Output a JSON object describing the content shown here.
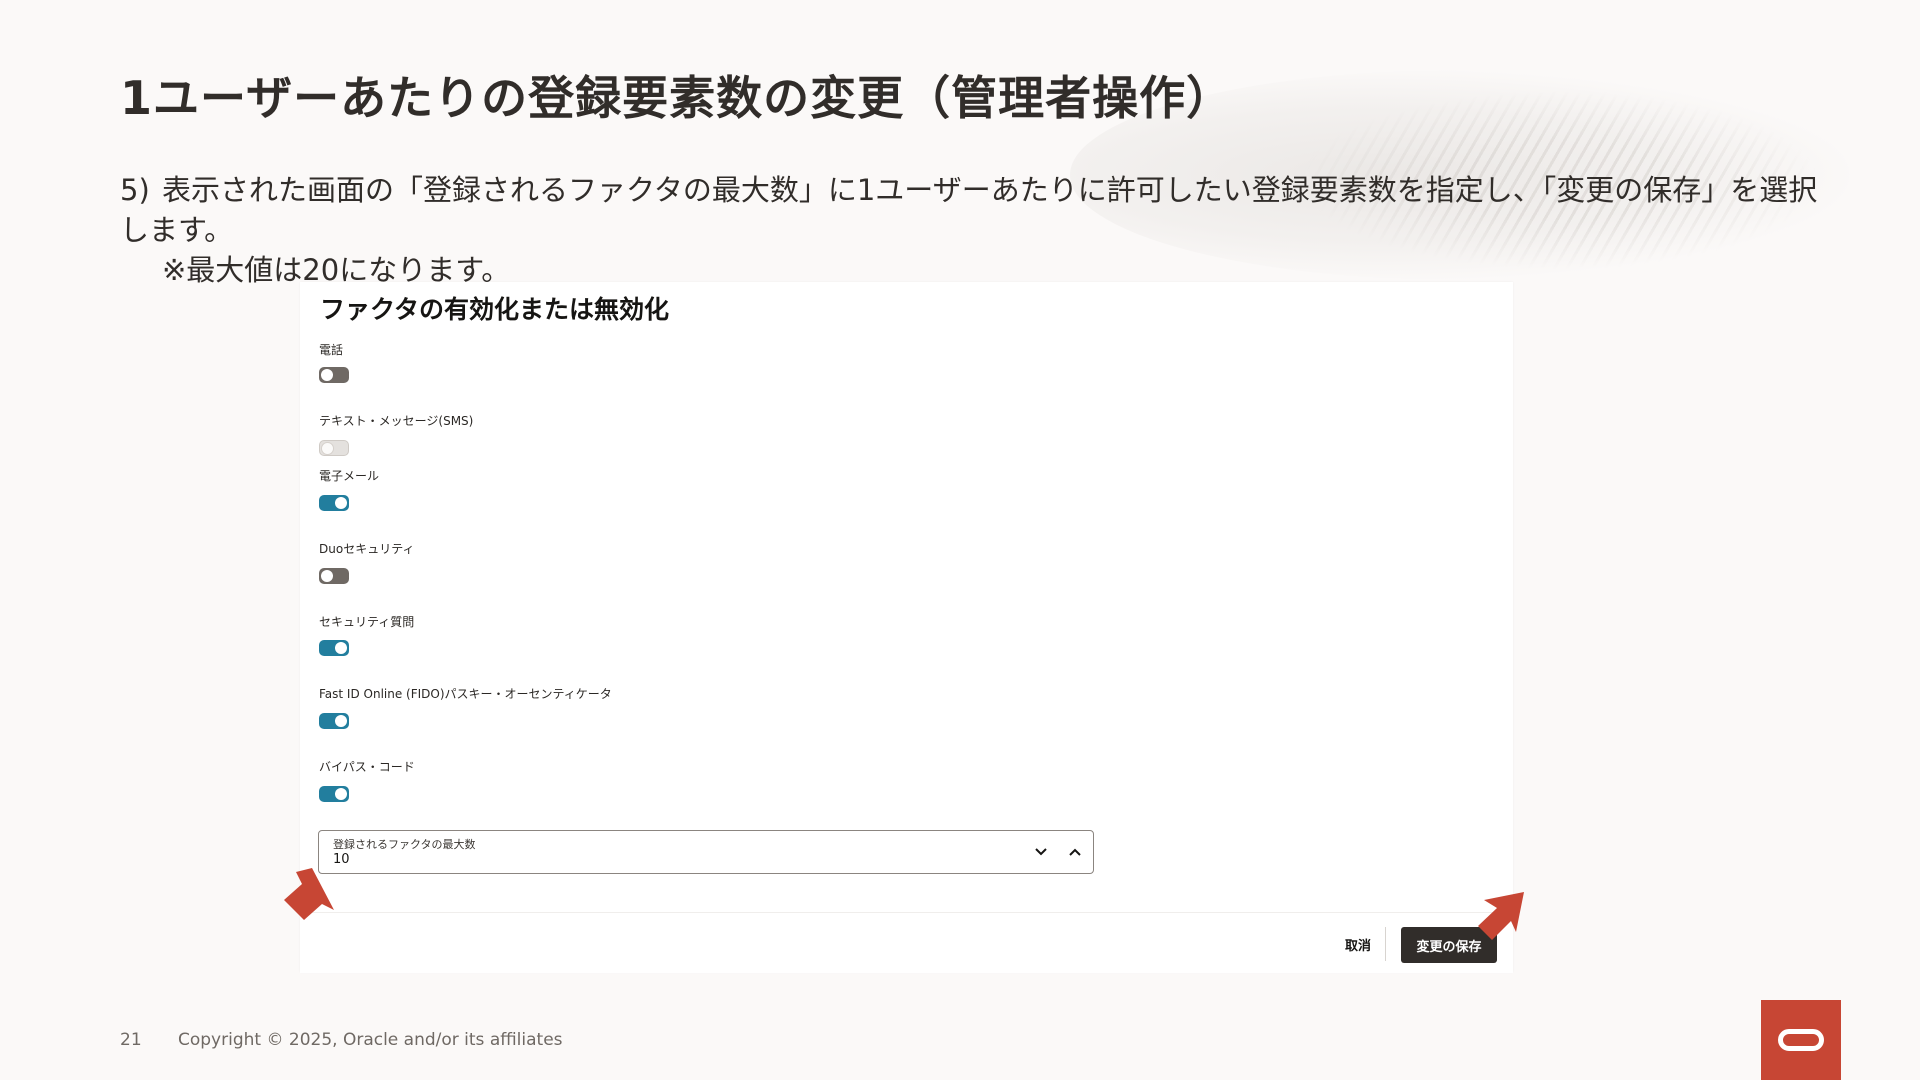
{
  "slide": {
    "title": "1ユーザーあたりの登録要素数の変更（管理者操作）",
    "instruction_number": "5)",
    "instruction_line1": "表示された画面の「登録されるファクタの最大数」に1ユーザーあたりに許可したい登録要素数を指定し、「変更の保存」を選択します。",
    "instruction_line2": "※最大値は20になります。",
    "page_number": "21",
    "copyright": "Copyright © 2025, Oracle and/or its affiliates"
  },
  "panel": {
    "title": "ファクタの有効化または無効化",
    "factors": [
      {
        "label": "電話",
        "state": "off"
      },
      {
        "label": "テキスト・メッセージ(SMS)",
        "state": "disabled"
      },
      {
        "label": "電子メール",
        "state": "on"
      },
      {
        "label": "Duoセキュリティ",
        "state": "off"
      },
      {
        "label": "セキュリティ質問",
        "state": "on"
      },
      {
        "label": "Fast ID Online (FIDO)パスキー・オーセンティケータ",
        "state": "on"
      },
      {
        "label": "バイパス・コード",
        "state": "on"
      }
    ],
    "max_factors": {
      "label": "登録されるファクタの最大数",
      "value": "10",
      "decrement_icon": "chevron-down-icon",
      "increment_icon": "chevron-up-icon"
    },
    "cancel_label": "取消",
    "save_label": "変更の保存"
  },
  "colors": {
    "toggle_on": "#227e9e",
    "toggle_off": "#6f6964",
    "save_button": "#312d2a",
    "arrow": "#c74634",
    "oracle_logo": "#c74634"
  }
}
